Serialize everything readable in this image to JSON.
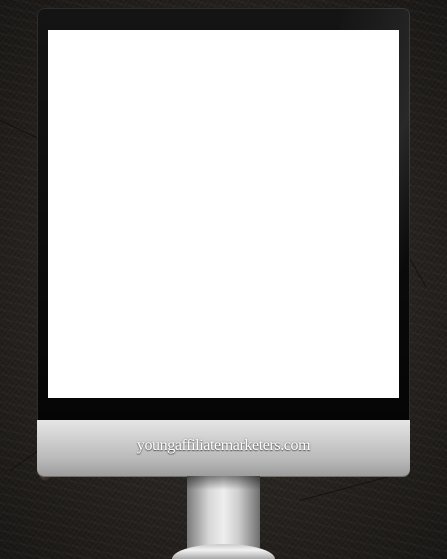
{
  "watermark": {
    "text": "youngaffiliatemarketers.com"
  },
  "colors": {
    "screen": "#ffffff",
    "bezel": "#0a0a0a",
    "chin": "#c4c4c4",
    "background": "#2a2724"
  },
  "icons": {
    "device": "monitor-icon"
  }
}
